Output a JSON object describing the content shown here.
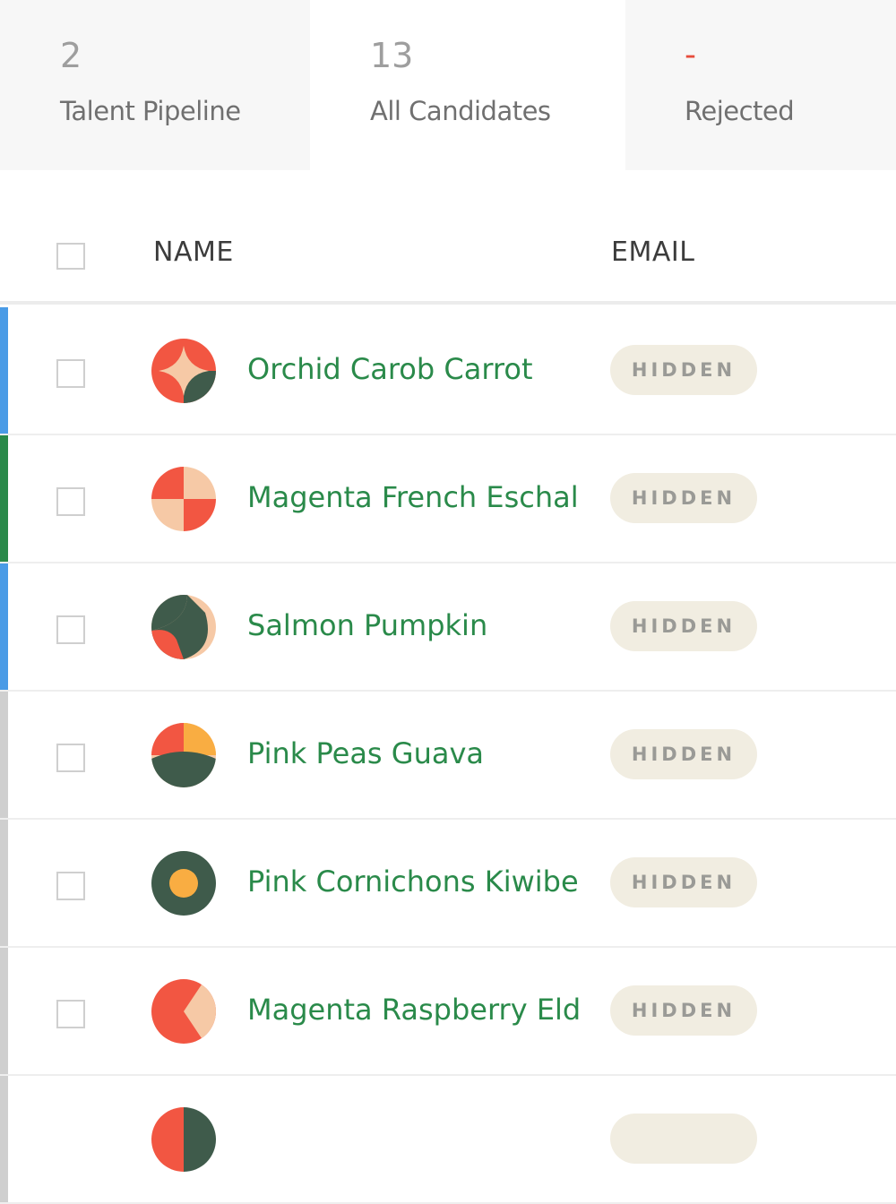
{
  "tabs": [
    {
      "count": "2",
      "label": "Talent Pipeline"
    },
    {
      "count": "13",
      "label": "All Candidates"
    },
    {
      "count": "-",
      "label": "Rejected"
    }
  ],
  "table": {
    "headers": {
      "name": "NAME",
      "email": "EMAIL"
    },
    "rows": [
      {
        "name": "Orchid Carob Carrot",
        "email": "HIDDEN",
        "status_color": "#4a9be6",
        "avatar": "star-avatar"
      },
      {
        "name": "Magenta French Eschal",
        "email": "HIDDEN",
        "status_color": "#2a8a4a",
        "avatar": "quadrant-avatar"
      },
      {
        "name": "Salmon Pumpkin",
        "email": "HIDDEN",
        "status_color": "#4a9be6",
        "avatar": "leaf-avatar"
      },
      {
        "name": "Pink Peas Guava",
        "email": "HIDDEN",
        "status_color": "#cfcfcf",
        "avatar": "split-avatar"
      },
      {
        "name": "Pink Cornichons Kiwibe",
        "email": "HIDDEN",
        "status_color": "#cfcfcf",
        "avatar": "ring-avatar"
      },
      {
        "name": "Magenta Raspberry Eld",
        "email": "HIDDEN",
        "status_color": "#cfcfcf",
        "avatar": "wedge-avatar"
      },
      {
        "name": "",
        "email": "",
        "status_color": "#cfcfcf",
        "avatar": "partial-avatar"
      }
    ]
  },
  "colors": {
    "accent_green": "#2a8a4a",
    "coral": "#f25642",
    "peach": "#f6c9a6",
    "dark_green": "#3f5b4b",
    "yellow": "#f9ad42",
    "badge_bg": "#f1ede1"
  }
}
